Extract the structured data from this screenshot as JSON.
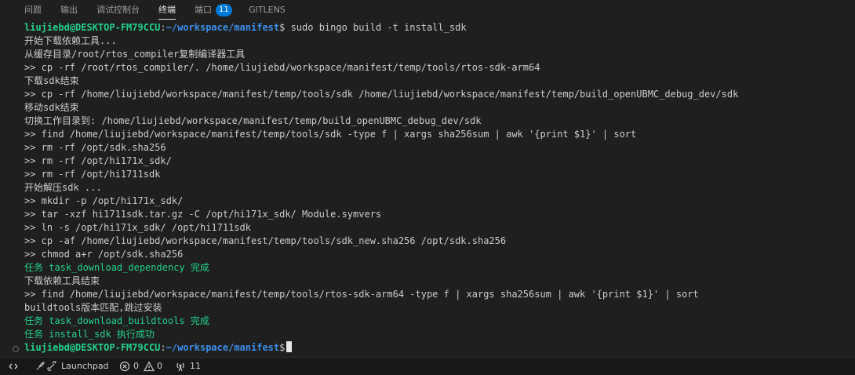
{
  "tabs": [
    {
      "label": "问题"
    },
    {
      "label": "输出"
    },
    {
      "label": "调试控制台"
    },
    {
      "label": "终端",
      "active": true
    },
    {
      "label": "端口",
      "badge": "11"
    },
    {
      "label": "GITLENS"
    }
  ],
  "terminal": {
    "prompt_user": "liujiebd@DESKTOP-FM79CCU",
    "prompt_colon": ":",
    "prompt_path": "~/workspace/manifest",
    "prompt_dollar": "$",
    "command": " sudo bingo build -t install_sdk",
    "lines": [
      "开始下载依赖工具...",
      "从缓存目录/root/rtos_compiler复制编译器工具",
      ">> cp -rf /root/rtos_compiler/. /home/liujiebd/workspace/manifest/temp/tools/rtos-sdk-arm64",
      "下载sdk结束",
      ">> cp -rf /home/liujiebd/workspace/manifest/temp/tools/sdk /home/liujiebd/workspace/manifest/temp/build_openUBMC_debug_dev/sdk",
      "移动sdk结束",
      "切换工作目录到: /home/liujiebd/workspace/manifest/temp/build_openUBMC_debug_dev/sdk",
      ">> find /home/liujiebd/workspace/manifest/temp/tools/sdk -type f | xargs sha256sum | awk '{print $1}' | sort",
      ">> rm -rf /opt/sdk.sha256",
      ">> rm -rf /opt/hi171x_sdk/",
      ">> rm -rf /opt/hi1711sdk",
      "开始解压sdk ...",
      ">> mkdir -p /opt/hi171x_sdk/",
      ">> tar -xzf hi1711sdk.tar.gz -C /opt/hi171x_sdk/ Module.symvers",
      ">> ln -s /opt/hi171x_sdk/ /opt/hi1711sdk",
      ">> cp -af /home/liujiebd/workspace/manifest/temp/tools/sdk_new.sha256 /opt/sdk.sha256",
      ">> chmod a+r /opt/sdk.sha256",
      "任务 task_download_dependency 完成",
      "下载依赖工具结束",
      ">> find /home/liujiebd/workspace/manifest/temp/tools/rtos-sdk-arm64 -type f | xargs sha256sum | awk '{print $1}' | sort",
      "buildtools版本匹配,跳过安装",
      "任务 task_download_buildtools 完成",
      "任务 install_sdk 执行成功"
    ]
  },
  "statusbar": {
    "launchpad_label": "Launchpad",
    "errors": "0",
    "warnings": "0",
    "ports": "11"
  },
  "colors": {
    "background": "#1f1f1f",
    "success_green": "#23d18b",
    "path_blue": "#3b8eea",
    "badge_blue": "#0078d4"
  }
}
